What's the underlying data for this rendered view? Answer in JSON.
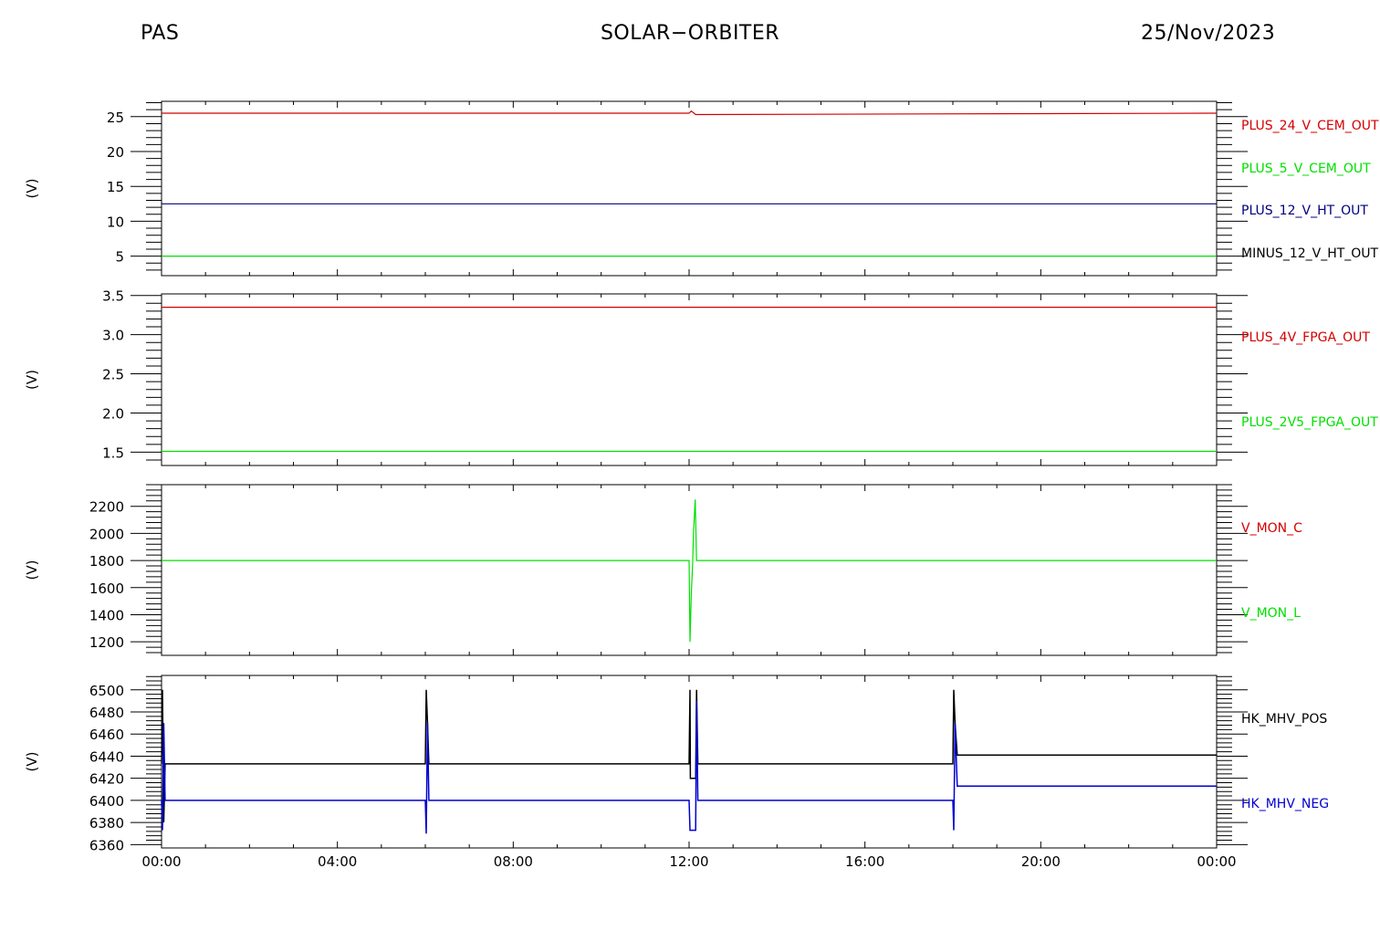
{
  "header": {
    "left": "PAS",
    "center": "SOLAR−ORBITER",
    "right": "25/Nov/2023"
  },
  "x_ticks": [
    "00:00",
    "04:00",
    "08:00",
    "12:00",
    "16:00",
    "20:00",
    "00:00"
  ],
  "chart_data": [
    {
      "type": "line",
      "ylabel": "(V)",
      "ylim": [
        2.2,
        27.2
      ],
      "yticks": [
        5,
        10,
        15,
        20,
        25
      ],
      "xlim": [
        0,
        24
      ],
      "series": [
        {
          "name": "PLUS_24_V_CEM_OUT",
          "color": "#d40000",
          "x": [
            0,
            12.0,
            12.05,
            12.15,
            24
          ],
          "y": [
            25.5,
            25.5,
            25.8,
            25.3,
            25.5
          ]
        },
        {
          "name": "PLUS_5_V_CEM_OUT",
          "color": "#00e000",
          "x": [
            0,
            24
          ],
          "y": [
            5.0,
            5.0
          ]
        },
        {
          "name": "PLUS_12_V_HT_OUT",
          "color": "#000080",
          "x": [
            0,
            24
          ],
          "y": [
            12.5,
            12.5
          ]
        },
        {
          "name": "MINUS_12_V_HT_OUT",
          "color": "#000000",
          "x": [],
          "y": []
        }
      ]
    },
    {
      "type": "line",
      "ylabel": "(V)",
      "ylim": [
        1.33,
        3.52
      ],
      "yticks": [
        1.5,
        2.0,
        2.5,
        3.0,
        3.5
      ],
      "xlim": [
        0,
        24
      ],
      "series": [
        {
          "name": "PLUS_4V_FPGA_OUT",
          "color": "#d40000",
          "x": [
            0,
            24
          ],
          "y": [
            3.35,
            3.35
          ]
        },
        {
          "name": "PLUS_2V5_FPGA_OUT",
          "color": "#00e000",
          "x": [
            0,
            24
          ],
          "y": [
            1.51,
            1.51
          ]
        }
      ]
    },
    {
      "type": "line",
      "ylabel": "(V)",
      "ylim": [
        1100,
        2360
      ],
      "yticks": [
        1200,
        1400,
        1600,
        1800,
        2000,
        2200
      ],
      "xlim": [
        0,
        24
      ],
      "series": [
        {
          "name": "V_MON_C",
          "color": "#d40000",
          "x": [],
          "y": []
        },
        {
          "name": "V_MON_L",
          "color": "#00e000",
          "x": [
            0,
            12.0,
            12.02,
            12.05,
            12.08,
            12.1,
            12.14,
            12.17,
            12.2,
            24
          ],
          "y": [
            1800,
            1800,
            1200,
            1550,
            1780,
            2000,
            2250,
            1800,
            1800,
            1800
          ]
        }
      ]
    },
    {
      "type": "line",
      "ylabel": "(V)",
      "ylim": [
        6357,
        6513
      ],
      "yticks": [
        6360,
        6380,
        6400,
        6420,
        6440,
        6460,
        6480,
        6500
      ],
      "xlim": [
        0,
        24
      ],
      "series": [
        {
          "name": "HK_MHV_POS",
          "color": "#000000",
          "x": [
            0,
            0.02,
            0.05,
            0.08,
            6.0,
            6.02,
            6.05,
            6.08,
            12.0,
            12.02,
            12.03,
            12.15,
            12.17,
            12.2,
            18.0,
            18.02,
            18.05,
            18.1,
            24
          ],
          "y": [
            6433,
            6500,
            6380,
            6433,
            6433,
            6500,
            6470,
            6433,
            6433,
            6500,
            6420,
            6420,
            6500,
            6433,
            6433,
            6500,
            6470,
            6441,
            6441
          ]
        },
        {
          "name": "HK_MHV_NEG",
          "color": "#0000d0",
          "x": [
            0,
            0.02,
            0.05,
            0.08,
            6.0,
            6.02,
            6.05,
            6.08,
            12.0,
            12.02,
            12.03,
            12.15,
            12.17,
            12.2,
            18.0,
            18.02,
            18.05,
            18.1,
            24
          ],
          "y": [
            6400,
            6373,
            6470,
            6400,
            6400,
            6370,
            6470,
            6400,
            6400,
            6373,
            6373,
            6373,
            6490,
            6400,
            6400,
            6373,
            6470,
            6413,
            6413
          ]
        }
      ]
    }
  ]
}
